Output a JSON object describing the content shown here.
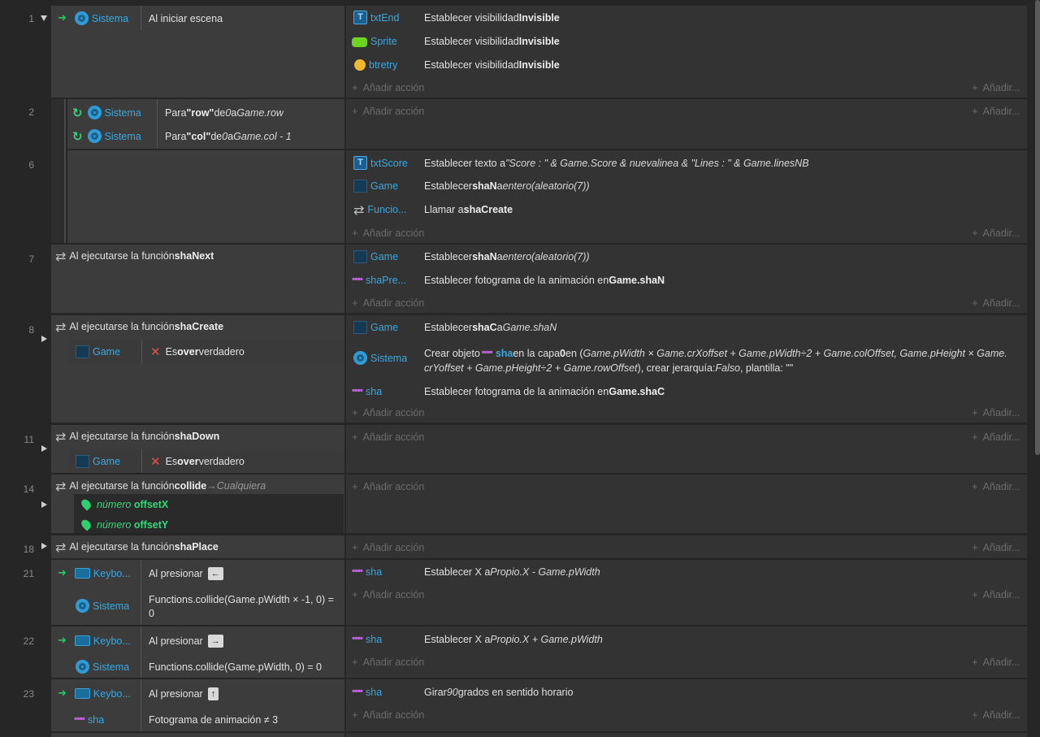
{
  "events": {
    "e1": {
      "line": "1",
      "cond_object": "Sistema",
      "cond_text": "Al iniciar escena",
      "actions": [
        {
          "object": "txtEnd",
          "pre": "Establecer visibilidad ",
          "bold": "Invisible"
        },
        {
          "object": "Sprite",
          "pre": "Establecer visibilidad ",
          "bold": "Invisible"
        },
        {
          "object": "btretry",
          "pre": "Establecer visibilidad ",
          "bold": "Invisible"
        }
      ]
    },
    "e2": {
      "line": "2",
      "cond1_object": "Sistema",
      "cond1_pre": "Para ",
      "cond1_bold": "\"row\"",
      "cond1_mid": " de ",
      "cond1_i1": "0",
      "cond1_mid2": " a ",
      "cond1_i2": "Game.row",
      "cond2_object": "Sistema",
      "cond2_pre": "Para ",
      "cond2_bold": "\"col\"",
      "cond2_mid": " de ",
      "cond2_i1": "0",
      "cond2_mid2": " a ",
      "cond2_i2": "Game.col - 1"
    },
    "e6": {
      "line": "6",
      "a1_object": "txtScore",
      "a1_pre": "Establecer texto a ",
      "a1_expr": "\"Score : \" & Game.Score & nuevalinea & \"Lines : \" & Game.linesNB",
      "a2_object": "Game",
      "a2_pre": "Establecer ",
      "a2_bold": "shaN",
      "a2_mid": " a ",
      "a2_expr": "entero(aleatorio(7))",
      "a3_object": "Funcio...",
      "a3_pre": "Llamar a ",
      "a3_bold": "shaCreate"
    },
    "e7": {
      "line": "7",
      "pre": "Al ejecutarse la función ",
      "bold": "shaNext",
      "a1_object": "Game",
      "a1_pre": "Establecer ",
      "a1_bold": "shaN",
      "a1_mid": " a ",
      "a1_expr": "entero(aleatorio(7))",
      "a2_object": "shaPre...",
      "a2_pre": "Establecer fotograma de la animación en ",
      "a2_bold": "Game.shaN"
    },
    "e8": {
      "line": "8",
      "pre": "Al ejecutarse la función ",
      "bold": "shaCreate",
      "sub_object": "Game",
      "sub_pre": "Es ",
      "sub_bold": "over",
      "sub_post": " verdadero",
      "a1_object": "Game",
      "a1_pre": "Establecer ",
      "a1_bold": "shaC",
      "a1_mid": " a ",
      "a1_expr": "Game.shaN",
      "a2_object": "Sistema",
      "a2_line1_pre": "Crear objeto ",
      "a2_line1_obj": "sha",
      "a2_line1_mid": " en la capa ",
      "a2_line1_bold": "0",
      "a2_line1_post": " en (",
      "a2_line1_expr": "Game.pWidth × Game.crXoffset + Game.pWidth÷2 + Game.colOffset, Game.pHeight × Game.",
      "a2_line2_expr": "crYoffset + Game.pHeight÷2 + Game.rowOffset",
      "a2_line2_post": "), crear jerarquía: ",
      "a2_line2_i": "Falso",
      "a2_line2_end": ", plantilla: \"\"",
      "a3_object": "sha",
      "a3_pre": "Establecer fotograma de la animación en ",
      "a3_bold": "Game.shaC"
    },
    "e11": {
      "line": "11",
      "pre": "Al ejecutarse la función ",
      "bold": "shaDown",
      "sub_object": "Game",
      "sub_pre": "Es ",
      "sub_bold": "over",
      "sub_post": " verdadero"
    },
    "e14": {
      "line": "14",
      "pre": "Al ejecutarse la función ",
      "bold": "collide",
      "arrow": " → ",
      "italic": "Cualquiera",
      "p1_type": "número",
      "p1_name": "offsetX",
      "p2_type": "número",
      "p2_name": "offsetY"
    },
    "e18": {
      "line": "18",
      "pre": "Al ejecutarse la función ",
      "bold": "shaPlace"
    },
    "e21": {
      "line": "21",
      "c1_object": "Keybo...",
      "c1_text": "Al presionar",
      "c1_key": "←",
      "c2_object": "Sistema",
      "c2_text_l1": "Functions.collide(Game.pWidth × -1, 0) =",
      "c2_text_l2": "0",
      "a1_object": "sha",
      "a1_pre": "Establecer X a ",
      "a1_expr": "Propio.X - Game.pWidth"
    },
    "e22": {
      "line": "22",
      "c1_object": "Keybo...",
      "c1_text": "Al presionar",
      "c1_key": "→",
      "c2_object": "Sistema",
      "c2_text": "Functions.collide(Game.pWidth, 0) = 0",
      "a1_object": "sha",
      "a1_pre": "Establecer X a ",
      "a1_expr": "Propio.X + Game.pWidth"
    },
    "e23": {
      "line": "23",
      "c1_object": "Keybo...",
      "c1_text": "Al presionar",
      "c1_key": "↑",
      "c2_object": "sha",
      "c2_text": "Fotograma de animación ≠ 3",
      "a1_object": "sha",
      "a1_pre": "Girar ",
      "a1_i": "90",
      "a1_post": " grados en sentido horario"
    }
  },
  "labels": {
    "add_action": "Añadir acción",
    "add_short": "Añadir..."
  },
  "colors": {
    "background": "#262626",
    "condition_bg": "#3c3c3c",
    "action_bg": "#333333",
    "object_blue": "#38a8e0",
    "trigger_green": "#21c866"
  },
  "icons": [
    "gear-icon",
    "text-object-icon",
    "sprite-icon",
    "emoji-icon",
    "game-object-icon",
    "loop-icon",
    "function-icon",
    "dotted-sprite-icon",
    "cross-icon",
    "pin-icon",
    "keyboard-icon",
    "trigger-arrow-icon"
  ]
}
